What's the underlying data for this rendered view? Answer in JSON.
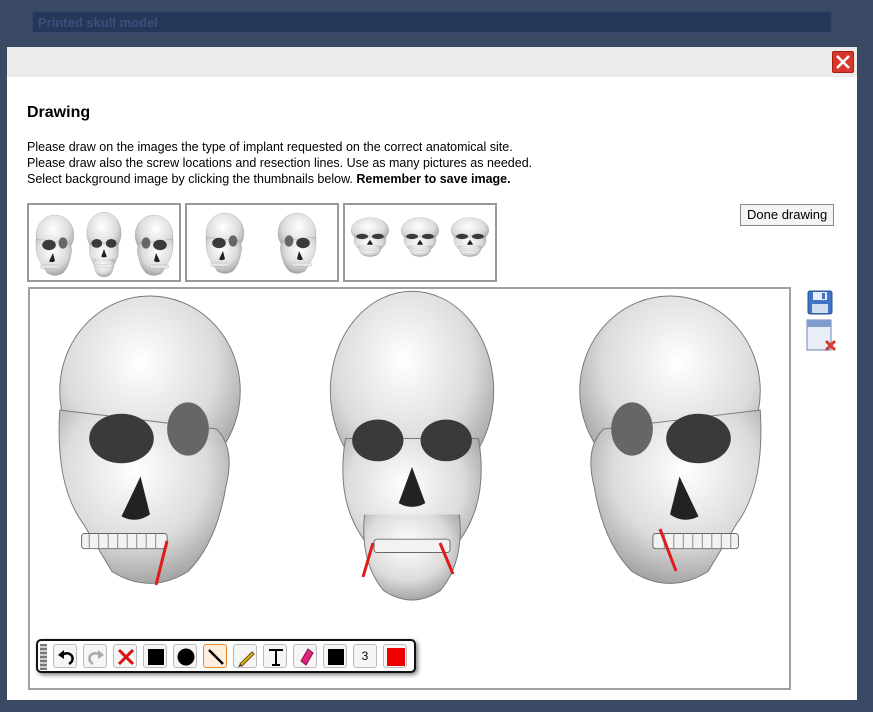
{
  "background": {
    "title": "Printed skull model"
  },
  "dialog": {
    "heading": "Drawing",
    "instructions": [
      "Please draw on the images the type of implant requested on the correct anatomical site.",
      "Please draw also the screw locations and resection lines. Use as many pictures as needed.",
      "Select background image by clicking the thumbnails below. "
    ],
    "instructions_bold": "Remember to save image.",
    "done_button": "Done drawing",
    "thumbnails": [
      "skull-three-views",
      "skull-two-oblique-views",
      "skull-inferior-views"
    ],
    "side_icons": [
      "save-icon",
      "clear-image-icon"
    ],
    "toolbar": {
      "tools": [
        "undo-icon",
        "redo-icon",
        "delete-icon",
        "square-shape-icon",
        "circle-shape-icon",
        "line-tool-icon",
        "pencil-icon",
        "text-tool-icon",
        "eraser-icon",
        "fill-color-swatch",
        "stroke-width",
        "stroke-color-swatch"
      ],
      "stroke_width": "3",
      "fill_color": "#000000",
      "stroke_color": "#ee0000",
      "selected_tool": "line-tool-icon"
    }
  }
}
